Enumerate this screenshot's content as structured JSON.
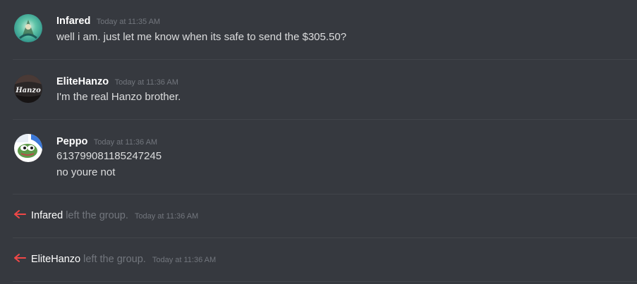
{
  "messages": [
    {
      "author": "Infared",
      "timestamp": "Today at 11:35 AM",
      "lines": [
        "well i am. just let me know when its safe to send the $305.50?"
      ]
    },
    {
      "author": "EliteHanzo",
      "timestamp": "Today at 11:36 AM",
      "avatar_text": "Hanzo",
      "lines": [
        "I'm the real Hanzo brother."
      ]
    },
    {
      "author": "Peppo",
      "timestamp": "Today at 11:36 AM",
      "lines": [
        "613799081185247245",
        "no youre not"
      ]
    }
  ],
  "system_events": [
    {
      "who": "Infared",
      "action": "left the group.",
      "timestamp": "Today at 11:36 AM",
      "icon": "arrow-left-icon"
    },
    {
      "who": "EliteHanzo",
      "action": "left the group.",
      "timestamp": "Today at 11:36 AM",
      "icon": "arrow-left-icon"
    }
  ],
  "colors": {
    "background": "#36393f",
    "username": "#ffffff",
    "text": "#dcddde",
    "timestamp": "#72767d",
    "leave_arrow": "#f04747"
  }
}
